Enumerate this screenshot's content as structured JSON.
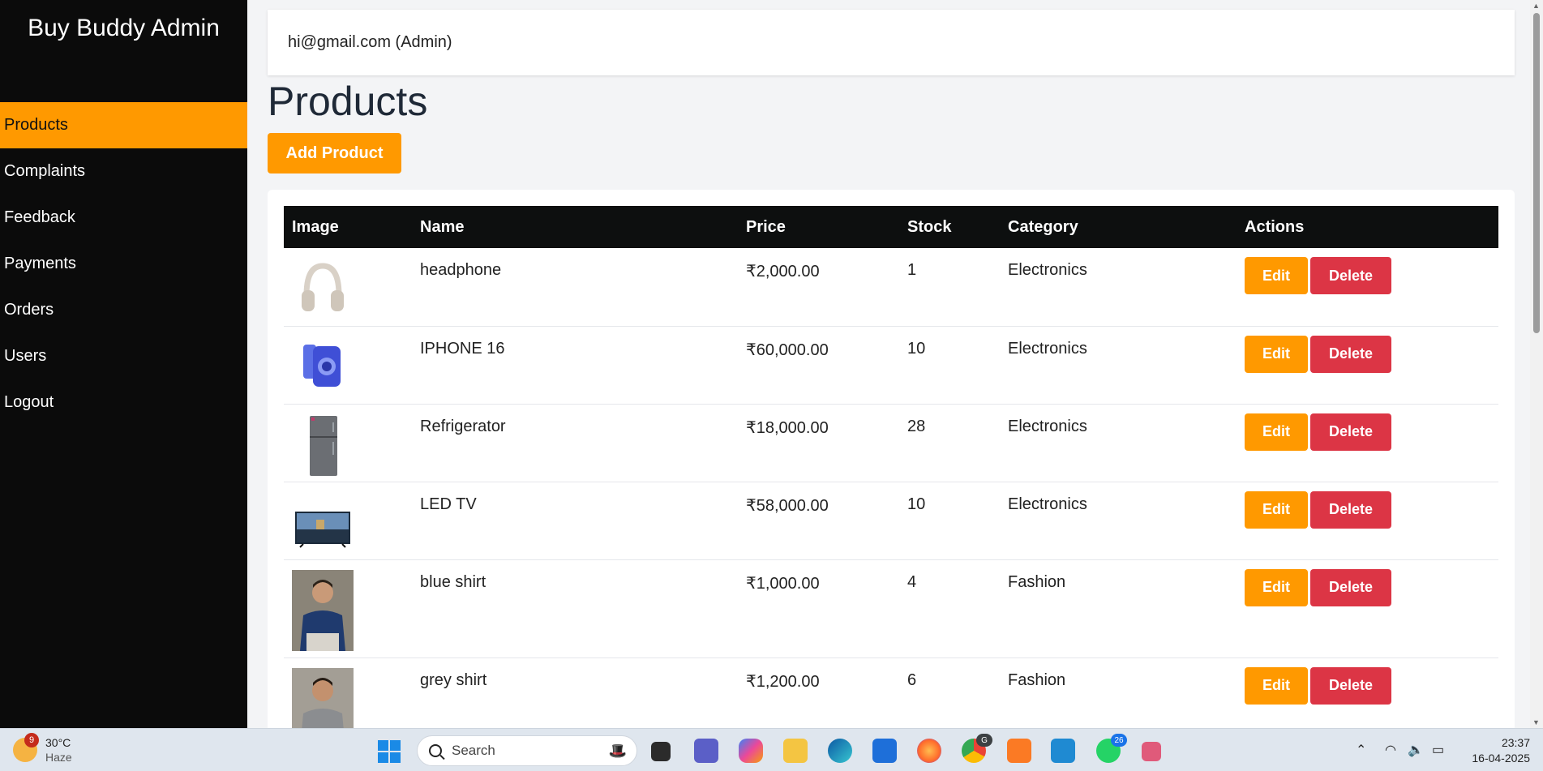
{
  "brand": "Buy Buddy Admin",
  "nav": [
    {
      "label": "Products",
      "active": true
    },
    {
      "label": "Complaints"
    },
    {
      "label": "Feedback"
    },
    {
      "label": "Payments"
    },
    {
      "label": "Orders"
    },
    {
      "label": "Users"
    },
    {
      "label": "Logout"
    }
  ],
  "user": "hi@gmail.com (Admin)",
  "page_title": "Products",
  "add_button": "Add Product",
  "table": {
    "headers": [
      "Image",
      "Name",
      "Price",
      "Stock",
      "Category",
      "Actions"
    ],
    "edit_label": "Edit",
    "delete_label": "Delete",
    "rows": [
      {
        "name": "headphone",
        "price": "₹2,000.00",
        "stock": "1",
        "category": "Electronics",
        "image": "headphone-image"
      },
      {
        "name": "IPHONE 16",
        "price": "₹60,000.00",
        "stock": "10",
        "category": "Electronics",
        "image": "iphone-image"
      },
      {
        "name": "Refrigerator",
        "price": "₹18,000.00",
        "stock": "28",
        "category": "Electronics",
        "image": "refrigerator-image"
      },
      {
        "name": "LED TV",
        "price": "₹58,000.00",
        "stock": "10",
        "category": "Electronics",
        "image": "led-tv-image"
      },
      {
        "name": "blue shirt",
        "price": "₹1,000.00",
        "stock": "4",
        "category": "Fashion",
        "image": "blue-shirt-image"
      },
      {
        "name": "grey shirt",
        "price": "₹1,200.00",
        "stock": "6",
        "category": "Fashion",
        "image": "grey-shirt-image"
      }
    ]
  },
  "colors": {
    "accent": "#ff9900",
    "danger": "#dc3545",
    "sidebar": "#0b0b0b"
  },
  "taskbar": {
    "weather_temp": "30°C",
    "weather_desc": "Haze",
    "weather_badge": "9",
    "search_placeholder": "Search",
    "whatsapp_badge": "26",
    "chrome_badge": "G",
    "time": "23:37",
    "date": "16-04-2025"
  }
}
